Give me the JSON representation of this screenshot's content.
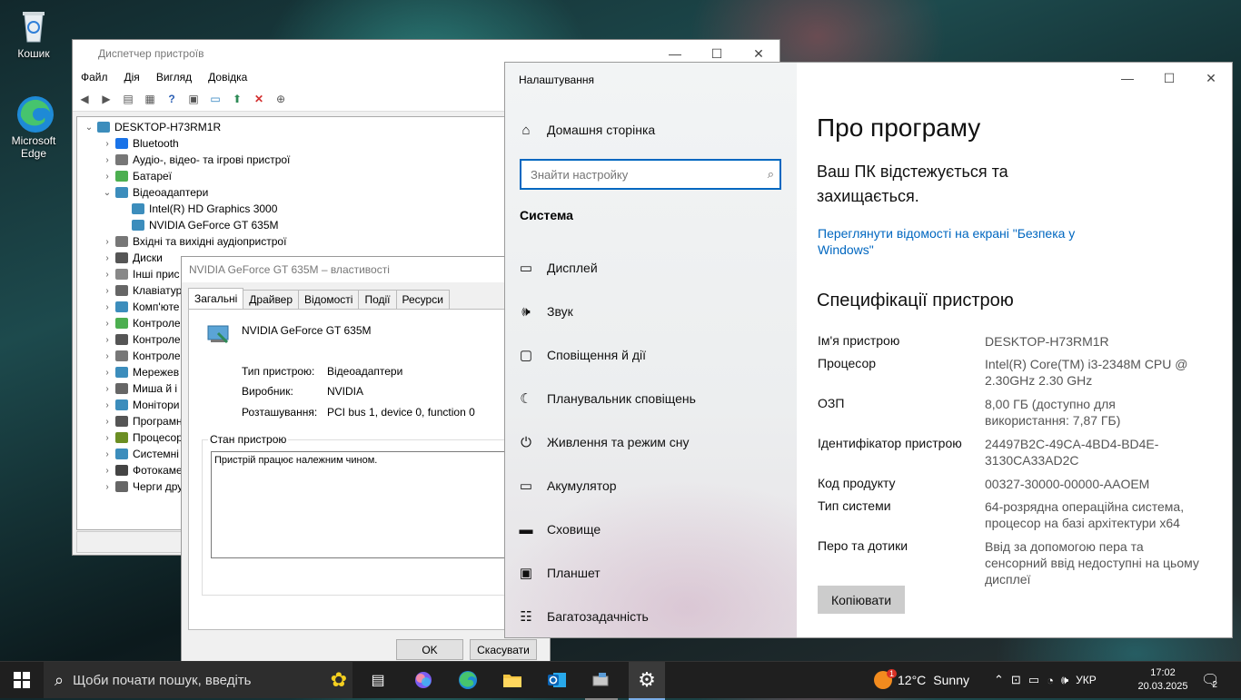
{
  "desktop": {
    "icons": [
      {
        "label": "Кошик"
      },
      {
        "label": "Microsoft Edge"
      }
    ]
  },
  "device_manager": {
    "title": "Диспетчер пристроїв",
    "menu": [
      "Файл",
      "Дія",
      "Вигляд",
      "Довідка"
    ],
    "root": "DESKTOP-H73RM1R",
    "tree": [
      {
        "label": "Bluetooth",
        "level": 1,
        "expanded": false,
        "color": "#1a73e8"
      },
      {
        "label": "Аудіо-, відео- та ігрові пристрої",
        "level": 1,
        "expanded": false,
        "color": "#777777"
      },
      {
        "label": "Батареї",
        "level": 1,
        "expanded": false,
        "color": "#4caf50"
      },
      {
        "label": "Відеоадаптери",
        "level": 1,
        "expanded": true,
        "color": "#3c8dbc"
      },
      {
        "label": "Intel(R) HD Graphics 3000",
        "level": 2,
        "expanded": null,
        "color": "#3c8dbc"
      },
      {
        "label": "NVIDIA GeForce GT 635M",
        "level": 2,
        "expanded": null,
        "color": "#3c8dbc"
      },
      {
        "label": "Вхідні та вихідні аудіопристрої",
        "level": 1,
        "expanded": false,
        "color": "#777777"
      },
      {
        "label": "Диски",
        "level": 1,
        "expanded": false,
        "color": "#555555"
      },
      {
        "label": "Інші прис",
        "level": 1,
        "expanded": false,
        "color": "#888888"
      },
      {
        "label": "Клавіатур",
        "level": 1,
        "expanded": false,
        "color": "#666666"
      },
      {
        "label": "Комп'юте",
        "level": 1,
        "expanded": false,
        "color": "#3c8dbc"
      },
      {
        "label": "Контроле",
        "level": 1,
        "expanded": false,
        "color": "#4caf50"
      },
      {
        "label": "Контроле",
        "level": 1,
        "expanded": false,
        "color": "#555555"
      },
      {
        "label": "Контроле",
        "level": 1,
        "expanded": false,
        "color": "#777777"
      },
      {
        "label": "Мережев",
        "level": 1,
        "expanded": false,
        "color": "#3c8dbc"
      },
      {
        "label": "Миша й і",
        "level": 1,
        "expanded": false,
        "color": "#666666"
      },
      {
        "label": "Монітори",
        "level": 1,
        "expanded": false,
        "color": "#3c8dbc"
      },
      {
        "label": "Програмн",
        "level": 1,
        "expanded": false,
        "color": "#555555"
      },
      {
        "label": "Процесор",
        "level": 1,
        "expanded": false,
        "color": "#6b8e23"
      },
      {
        "label": "Системні",
        "level": 1,
        "expanded": false,
        "color": "#3c8dbc"
      },
      {
        "label": "Фотокаме",
        "level": 1,
        "expanded": false,
        "color": "#444444"
      },
      {
        "label": "Черги дру",
        "level": 1,
        "expanded": false,
        "color": "#666666"
      }
    ]
  },
  "properties": {
    "title": "NVIDIA GeForce GT 635M – властивості",
    "tabs": [
      "Загальні",
      "Драйвер",
      "Відомості",
      "Події",
      "Ресурси"
    ],
    "device_name": "NVIDIA GeForce GT 635M",
    "rows": [
      {
        "label": "Тип пристрою:",
        "value": "Відеоадаптери"
      },
      {
        "label": "Виробник:",
        "value": "NVIDIA"
      },
      {
        "label": "Розташування:",
        "value": "PCI bus 1, device 0, function 0"
      }
    ],
    "status_legend": "Стан пристрою",
    "status_text": "Пристрій працює належним чином.",
    "ok_label": "OK",
    "cancel_label": "Скасувати"
  },
  "settings": {
    "window_title": "Налаштування",
    "home": "Домашня сторінка",
    "search_placeholder": "Знайти настройку",
    "section": "Система",
    "nav_items": [
      {
        "label": "Дисплей",
        "icon": "display-icon"
      },
      {
        "label": "Звук",
        "icon": "sound-icon"
      },
      {
        "label": "Сповіщення й дії",
        "icon": "notification-icon"
      },
      {
        "label": "Планувальник сповіщень",
        "icon": "moon-icon"
      },
      {
        "label": "Живлення та режим сну",
        "icon": "power-icon"
      },
      {
        "label": "Акумулятор",
        "icon": "battery-icon"
      },
      {
        "label": "Сховище",
        "icon": "storage-icon"
      },
      {
        "label": "Планшет",
        "icon": "tablet-icon"
      },
      {
        "label": "Багатозадачність",
        "icon": "multitask-icon"
      }
    ],
    "page_title": "Про програму",
    "protection_text": "Ваш ПК відстежується та захищається.",
    "security_link": "Переглянути відомості на екрані \"Безпека у Windows\"",
    "specs_title": "Специфікації пристрою",
    "specs": [
      {
        "label": "Ім'я пристрою",
        "value": "DESKTOP-H73RM1R"
      },
      {
        "label": "Процесор",
        "value": "Intel(R) Core(TM) i3-2348M CPU @ 2.30GHz   2.30 GHz"
      },
      {
        "label": "ОЗП",
        "value": "8,00 ГБ (доступно для використання: 7,87 ГБ)"
      },
      {
        "label": "Ідентифікатор пристрою",
        "value": "24497B2C-49CA-4BD4-BD4E-3130CA33AD2C"
      },
      {
        "label": "Код продукту",
        "value": "00327-30000-00000-AAOEM"
      },
      {
        "label": "Тип системи",
        "value": "64-розрядна операційна система, процесор на базі архітектури x64"
      },
      {
        "label": "Перо та дотики",
        "value": "Ввід за допомогою пера та сенсорний ввід недоступні на цьому дисплеї"
      }
    ],
    "copy_label": "Копіювати"
  },
  "taskbar": {
    "search_text": "Щоби почати пошук, введіть",
    "weather_temp": "12°C",
    "weather_cond": "Sunny",
    "weather_badge": "1",
    "lang": "УКР",
    "time": "17:02",
    "date": "20.03.2025",
    "notifications": "2",
    "colors": {
      "accent": "#0078d4",
      "taskbar": "#1f1f1f"
    }
  }
}
